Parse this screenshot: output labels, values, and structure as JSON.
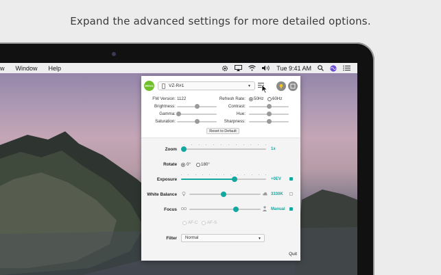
{
  "caption": "Expand the advanced settings for more detailed options.",
  "menubar": {
    "items": [
      "w",
      "Window",
      "Help"
    ],
    "clock": "Tue 9:41 AM",
    "icons": [
      "settings-gear-icon",
      "airplay-icon",
      "wifi-icon",
      "volume-icon",
      "search-icon",
      "siri-icon",
      "list-icon"
    ]
  },
  "panel": {
    "badge": "IPEVO",
    "device": "VZ-R#1",
    "fw_label": "FW Version:",
    "fw_value": "1122",
    "refresh_label": "Refresh Rate:",
    "refresh_options": [
      "50Hz",
      "60Hz"
    ],
    "refresh_selected": "50Hz",
    "left_sliders": [
      {
        "label": "Brightness:",
        "level": 0.5
      },
      {
        "label": "Gamma:",
        "level": 0.05
      },
      {
        "label": "Saturation:",
        "level": 0.5
      }
    ],
    "right_sliders": [
      {
        "label": "Contrast:",
        "level": 0.5
      },
      {
        "label": "Hue:",
        "level": 0.5
      },
      {
        "label": "Sharpness:",
        "level": 0.5
      }
    ],
    "reset_label": "Reset to Default",
    "zoom": {
      "label": "Zoom",
      "value": "1x",
      "level": 0.0
    },
    "rotate": {
      "label": "Rotate",
      "options": [
        "0°",
        "180°"
      ],
      "selected": "0°"
    },
    "exposure": {
      "label": "Exposure",
      "value": "+0EV",
      "level": 0.63
    },
    "white_balance": {
      "label": "White Balance",
      "value": "3330K",
      "level": 0.48
    },
    "focus": {
      "label": "Focus",
      "value": "Manual",
      "level": 0.65,
      "af_options": [
        "AF-C",
        "AF-S"
      ]
    },
    "filter": {
      "label": "Filter",
      "value": "Normal"
    },
    "quit_label": "Quit",
    "accent": "#12a8a0"
  }
}
